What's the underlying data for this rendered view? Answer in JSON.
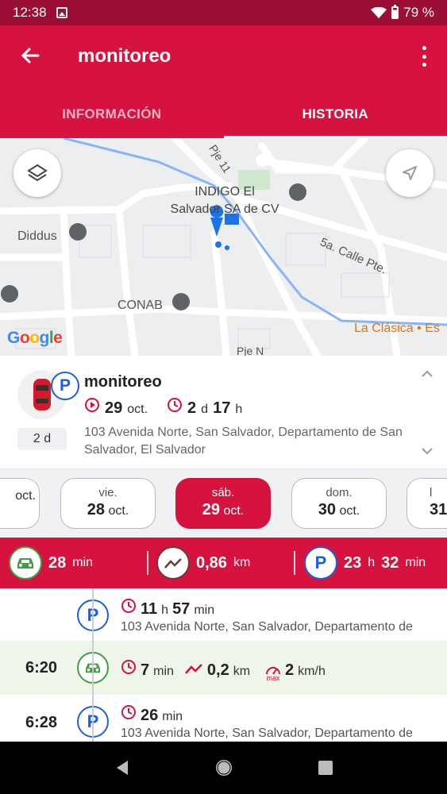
{
  "status": {
    "time": "12:38",
    "battery": "79 %"
  },
  "appbar": {
    "title": "monitoreo"
  },
  "tabs": [
    {
      "label": "INFORMACIÓN"
    },
    {
      "label": "HISTORIA"
    }
  ],
  "map": {
    "labels": {
      "pje11": "Pje 11",
      "indigo": "INDIGO El\nSalvador SA de CV",
      "diddus": "Diddus",
      "calle": "5a. Calle Pte.",
      "conab": "CONAB",
      "clasica": "La Clásica • Es",
      "pjen": "Pje N",
      "google": "Google"
    }
  },
  "vehicle": {
    "name": "monitoreo",
    "date_day": "29",
    "date_month": "oct.",
    "elapsed_d": "2",
    "elapsed_d_unit": "d",
    "elapsed_h": "17",
    "elapsed_h_unit": "h",
    "duration_pill": "2 d",
    "address": "103 Avenida Norte, San Salvador, Departamento de San Salvador, El Salvador"
  },
  "dates": [
    {
      "dow": "",
      "day": "",
      "month": "oct."
    },
    {
      "dow": "vie.",
      "day": "28",
      "month": "oct."
    },
    {
      "dow": "sáb.",
      "day": "29",
      "month": "oct."
    },
    {
      "dow": "dom.",
      "day": "30",
      "month": "oct."
    },
    {
      "dow": "l",
      "day": "31",
      "month": ""
    }
  ],
  "summary": {
    "drive_value": "28",
    "drive_unit": "min",
    "distance_value": "0,86",
    "distance_unit": "km",
    "park_h": "23",
    "park_h_unit": "h",
    "park_m": "32",
    "park_m_unit": "min"
  },
  "timeline": [
    {
      "type": "park",
      "time": "",
      "h": "11",
      "h_unit": "h",
      "m": "57",
      "m_unit": "min",
      "address": "103 Avenida Norte, San Salvador, Departamento de"
    },
    {
      "type": "drive",
      "time": "6:20",
      "dur": "7",
      "dur_unit": "min",
      "dist": "0,2",
      "dist_unit": "km",
      "speed": "2",
      "speed_unit": "km/h",
      "speed_badge": "max"
    },
    {
      "type": "park",
      "time": "6:28",
      "m": "26",
      "m_unit": "min",
      "address": "103 Avenida Norte, San Salvador, Departamento de"
    }
  ]
}
